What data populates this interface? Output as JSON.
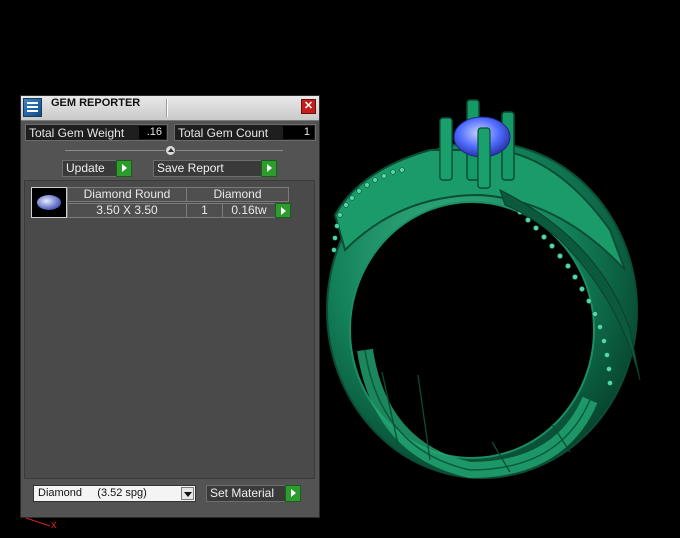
{
  "window": {
    "title": "GEM REPORTER",
    "close_glyph": "✕"
  },
  "stats": {
    "total_gem_weight_label": "Total Gem Weight",
    "total_gem_weight_value": ".16",
    "total_gem_count_label": "Total Gem Count",
    "total_gem_count_value": "1"
  },
  "actions": {
    "update_label": "Update",
    "save_report_label": "Save Report"
  },
  "gem_list": {
    "headers": {
      "shape": "Diamond Round",
      "material": "Diamond"
    },
    "rows": [
      {
        "size": "3.50 X 3.50",
        "count": "1",
        "weight": "0.16tw",
        "stone_icon": "diamond-round-icon"
      }
    ]
  },
  "material": {
    "selected": "Diamond     (3.52 spg)",
    "set_label": "Set Material"
  },
  "viewport": {
    "axis_label": "x",
    "ring_color": "#0f6a49",
    "stone_color": "#4f6cff"
  }
}
